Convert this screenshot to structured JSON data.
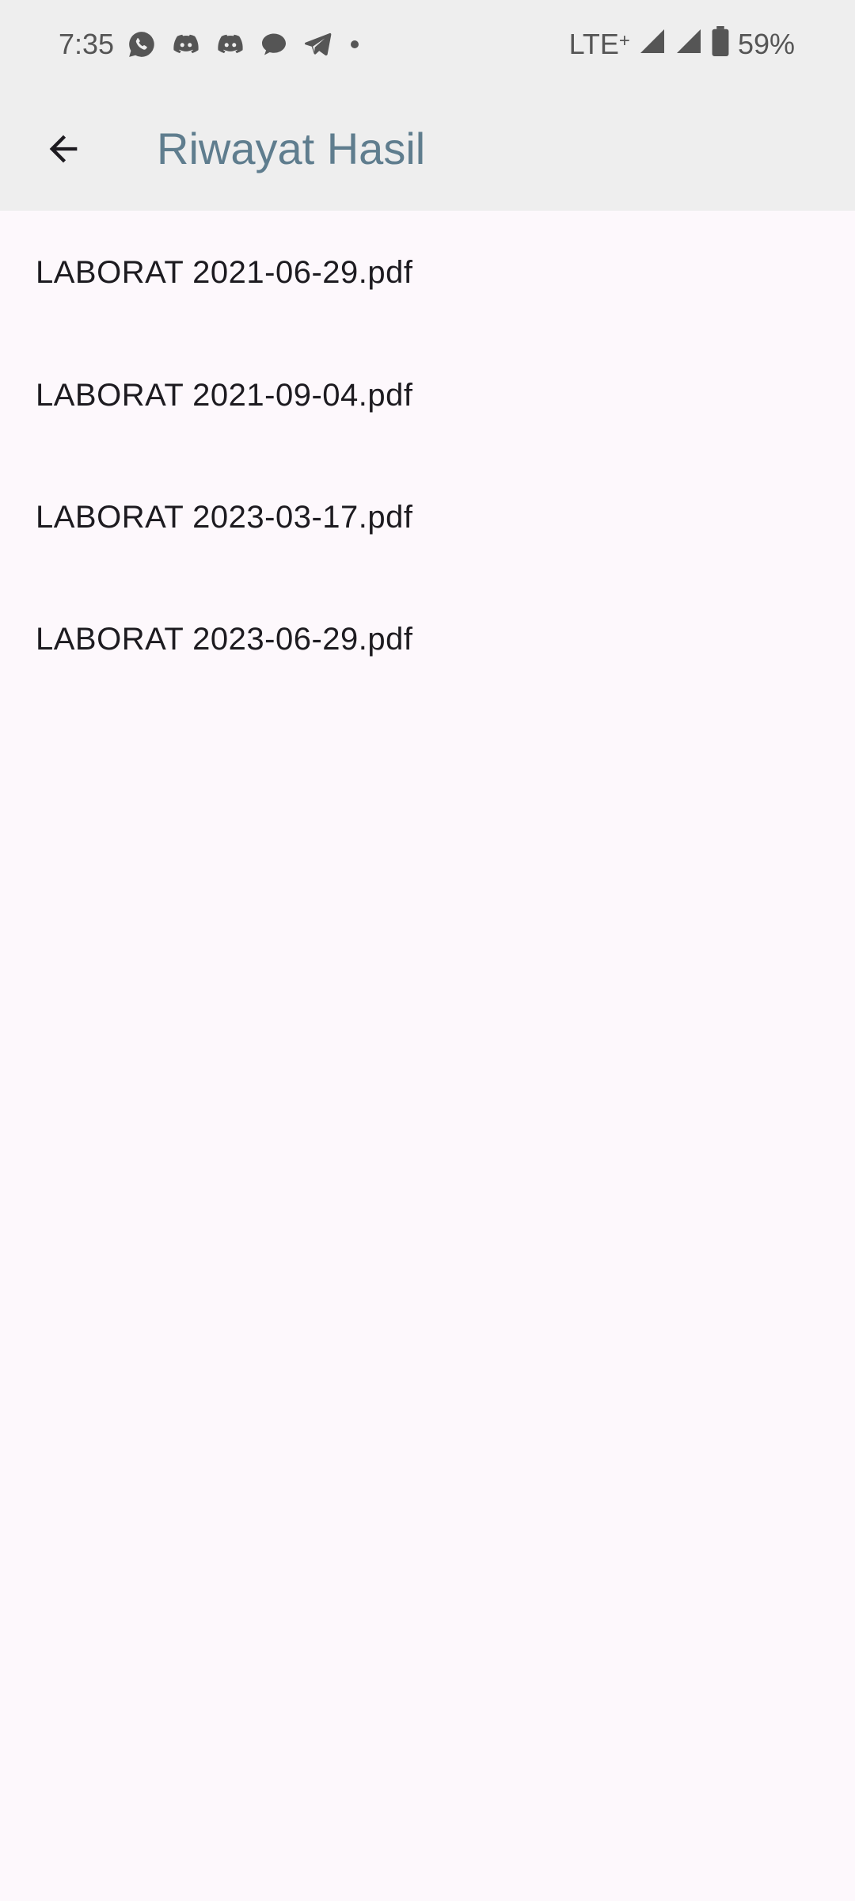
{
  "status_bar": {
    "time": "7:35",
    "notification_icons": [
      "whatsapp-icon",
      "discord-icon",
      "discord-icon",
      "chat-bubble-icon",
      "telegram-icon",
      "more-dot-icon"
    ],
    "network": "LTE",
    "network_suffix": "+",
    "battery": "59%"
  },
  "app_bar": {
    "back_icon": "arrow-back-icon",
    "title": "Riwayat Hasil"
  },
  "files": [
    {
      "name": "LABORAT 2021-06-29.pdf"
    },
    {
      "name": "LABORAT 2021-09-04.pdf"
    },
    {
      "name": "LABORAT 2023-03-17.pdf"
    },
    {
      "name": "LABORAT 2023-06-29.pdf"
    }
  ],
  "colors": {
    "app_bar_bg": "#eeeeee",
    "page_bg": "#fdf8fc",
    "title": "#5f7d8e",
    "text": "#1d1b20"
  }
}
